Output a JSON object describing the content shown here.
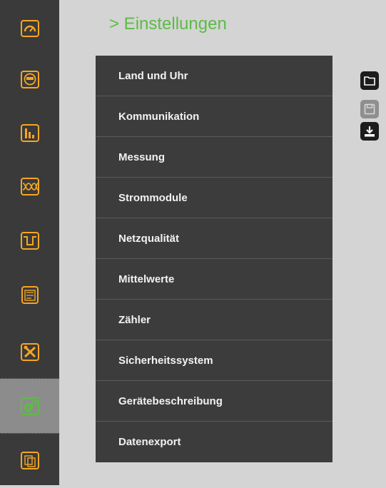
{
  "page": {
    "title": "> Einstellungen",
    "accent_color": "#5dbb46",
    "icon_color": "#f5a623"
  },
  "sidebar": {
    "active_index": 7,
    "items": [
      {
        "icon": "gauge-icon"
      },
      {
        "icon": "meter-icon"
      },
      {
        "icon": "bar-chart-icon"
      },
      {
        "icon": "waveform-icon"
      },
      {
        "icon": "dip-signal-icon"
      },
      {
        "icon": "event-list-icon"
      },
      {
        "icon": "tools-icon"
      },
      {
        "icon": "settings-gear-icon"
      },
      {
        "icon": "apps-icon"
      }
    ]
  },
  "menu": {
    "items": [
      {
        "label": "Land und Uhr"
      },
      {
        "label": "Kommunikation"
      },
      {
        "label": "Messung"
      },
      {
        "label": "Strommodule"
      },
      {
        "label": "Netzqualität"
      },
      {
        "label": "Mittelwerte"
      },
      {
        "label": "Zähler"
      },
      {
        "label": "Sicherheitssystem"
      },
      {
        "label": "Gerätebeschreibung"
      },
      {
        "label": "Datenexport"
      }
    ]
  },
  "toolbar": {
    "buttons": [
      {
        "icon": "folder-open-icon",
        "enabled": true
      },
      {
        "icon": "save-icon",
        "enabled": false
      },
      {
        "icon": "download-icon",
        "enabled": true
      }
    ]
  }
}
